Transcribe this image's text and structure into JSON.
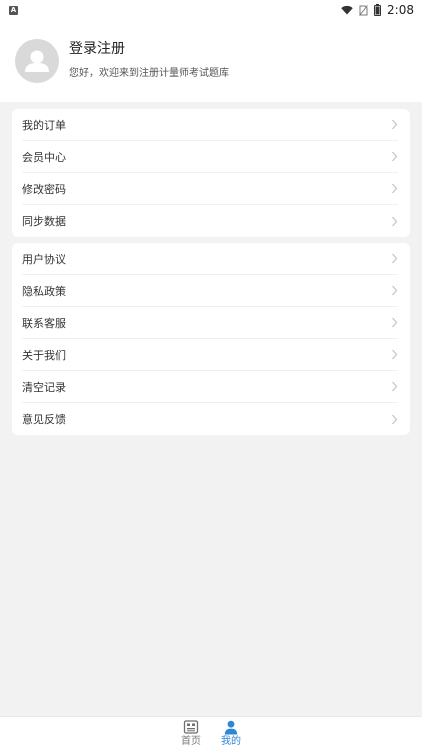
{
  "status_bar": {
    "notification_badge": "A",
    "time": "2:08",
    "icons": [
      "wifi-icon",
      "no-sim-icon",
      "battery-icon"
    ]
  },
  "profile": {
    "title": "登录注册",
    "subtitle": "您好，欢迎来到注册计量师考试题库"
  },
  "menu_group_1": [
    {
      "label": "我的订单"
    },
    {
      "label": "会员中心"
    },
    {
      "label": "修改密码"
    },
    {
      "label": "同步数据"
    }
  ],
  "menu_group_2": [
    {
      "label": "用户协议"
    },
    {
      "label": "隐私政策"
    },
    {
      "label": "联系客服"
    },
    {
      "label": "关于我们"
    },
    {
      "label": "清空记录"
    },
    {
      "label": "意见反馈"
    }
  ],
  "bottom_nav": {
    "items": [
      {
        "label": "首页",
        "icon": "home-grid-icon",
        "active": false
      },
      {
        "label": "我的",
        "icon": "person-icon",
        "active": true
      }
    ]
  },
  "colors": {
    "accent": "#2f86d6",
    "background": "#f2f2f2",
    "card": "#ffffff",
    "chevron": "#c4c4c4"
  }
}
